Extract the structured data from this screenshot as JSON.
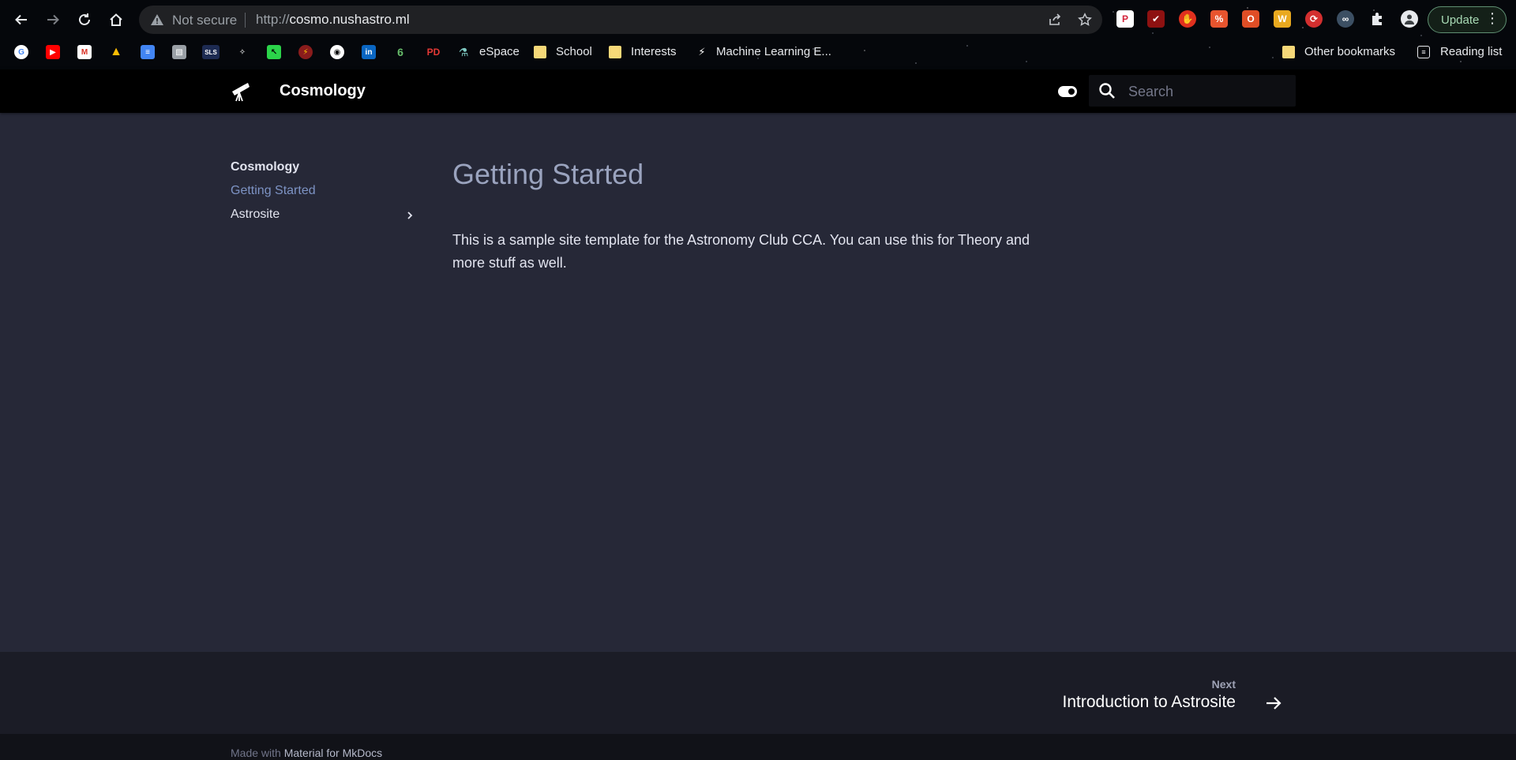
{
  "browser": {
    "security_label": "Not secure",
    "url_scheme": "http://",
    "url_host": "cosmo.nushastro.ml",
    "update_label": "Update",
    "extensions": [
      {
        "name": "pocket",
        "glyph": "P",
        "color": "#d3233a"
      },
      {
        "name": "ublock",
        "glyph": "✔",
        "color": "#b81d1d"
      },
      {
        "name": "stop",
        "glyph": "✋",
        "color": "#e0301e"
      },
      {
        "name": "percent",
        "glyph": "%",
        "color": "#e8542e"
      },
      {
        "name": "office",
        "glyph": "O",
        "color": "#e04e26"
      },
      {
        "name": "w",
        "glyph": "W",
        "color": "#e9a91f"
      },
      {
        "name": "sync",
        "glyph": "⟳",
        "color": "#d32f2f"
      },
      {
        "name": "glasses",
        "glyph": "∞",
        "color": "#3c4f63"
      }
    ],
    "bookmarks": {
      "espace": "eSpace",
      "school": "School",
      "interests": "Interests",
      "ml": "Machine Learning E...",
      "other": "Other bookmarks",
      "reading": "Reading list"
    },
    "bookmark_icons": [
      {
        "name": "google",
        "glyph": "G",
        "color": "#ffffff",
        "fg": "#4285f4"
      },
      {
        "name": "youtube",
        "glyph": "▶",
        "color": "#ff0000",
        "fg": "#ffffff"
      },
      {
        "name": "gmail",
        "glyph": "M",
        "color": "#d93025",
        "fg": "#ffffff"
      },
      {
        "name": "drive",
        "glyph": "▲",
        "color": "#0f9d58",
        "fg": "#fbbc04"
      },
      {
        "name": "docs",
        "glyph": "≡",
        "color": "#4285f4",
        "fg": "#ffffff"
      },
      {
        "name": "photo",
        "glyph": "▧",
        "color": "#9aa0a6",
        "fg": "#ffffff"
      },
      {
        "name": "sls",
        "glyph": "SLS",
        "color": "#1d2b52",
        "fg": "#ffffff"
      },
      {
        "name": "star",
        "glyph": "✧",
        "color": "#2a2a2a",
        "fg": "#ffffff"
      },
      {
        "name": "cursor",
        "glyph": "↖",
        "color": "#2bd44a",
        "fg": "#000000"
      },
      {
        "name": "flash",
        "glyph": "⚡",
        "color": "#8a1c1c",
        "fg": "#ffcc00"
      },
      {
        "name": "github",
        "glyph": "◉",
        "color": "#000000",
        "fg": "#ffffff"
      },
      {
        "name": "linkedin",
        "glyph": "in",
        "color": "#0a66c2",
        "fg": "#ffffff"
      },
      {
        "name": "leaf",
        "glyph": "6",
        "color": "#1b5e20",
        "fg": "#66bb6a"
      },
      {
        "name": "pd",
        "glyph": "PD",
        "color": "#2b1010",
        "fg": "#e53935"
      },
      {
        "name": "lab",
        "glyph": "⚗",
        "color": "#1d3d3a",
        "fg": "#80cbc4"
      }
    ]
  },
  "site": {
    "title": "Cosmology",
    "search_placeholder": "Search"
  },
  "nav": {
    "title": "Cosmology",
    "items": [
      {
        "label": "Getting Started",
        "active": true
      },
      {
        "label": "Astrosite",
        "has_children": true
      }
    ]
  },
  "content": {
    "heading": "Getting Started",
    "paragraph": "This is a sample site template for the Astronomy Club CCA. You can use this for Theory and more stuff as well."
  },
  "footer": {
    "next_caption": "Next",
    "next_title": "Introduction to Astrosite",
    "made_with": "Made with",
    "made_with_link": "Material for MkDocs"
  }
}
